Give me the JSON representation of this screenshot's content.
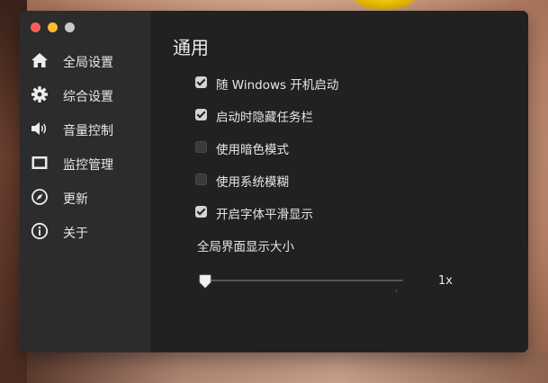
{
  "window": {
    "title_bar": {
      "controls": [
        "close",
        "minimize",
        "maximize"
      ]
    }
  },
  "sidebar": {
    "items": [
      {
        "label": "全局设置",
        "icon": "home-icon"
      },
      {
        "label": "综合设置",
        "icon": "gear-icon"
      },
      {
        "label": "音量控制",
        "icon": "speaker-icon"
      },
      {
        "label": "监控管理",
        "icon": "monitor-icon"
      },
      {
        "label": "更新",
        "icon": "compass-icon"
      },
      {
        "label": "关于",
        "icon": "info-icon"
      }
    ]
  },
  "main": {
    "title": "通用",
    "options": [
      {
        "label": "随 Windows 开机启动",
        "checked": true
      },
      {
        "label": "启动时隐藏任务栏",
        "checked": true
      },
      {
        "label": "使用暗色模式",
        "checked": false
      },
      {
        "label": "使用系统模糊",
        "checked": false
      },
      {
        "label": "开启字体平滑显示",
        "checked": true
      }
    ],
    "scale": {
      "label": "全局界面显示大小",
      "value_text": "1x",
      "value_fraction": 0.0
    }
  },
  "colors": {
    "sidebar_bg": "#2c2c2c",
    "content_bg": "#212121",
    "close": "#fc5f57",
    "minimize": "#fdbc2e",
    "maximize": "#c9c9c9",
    "text": "#e6e6e6"
  }
}
